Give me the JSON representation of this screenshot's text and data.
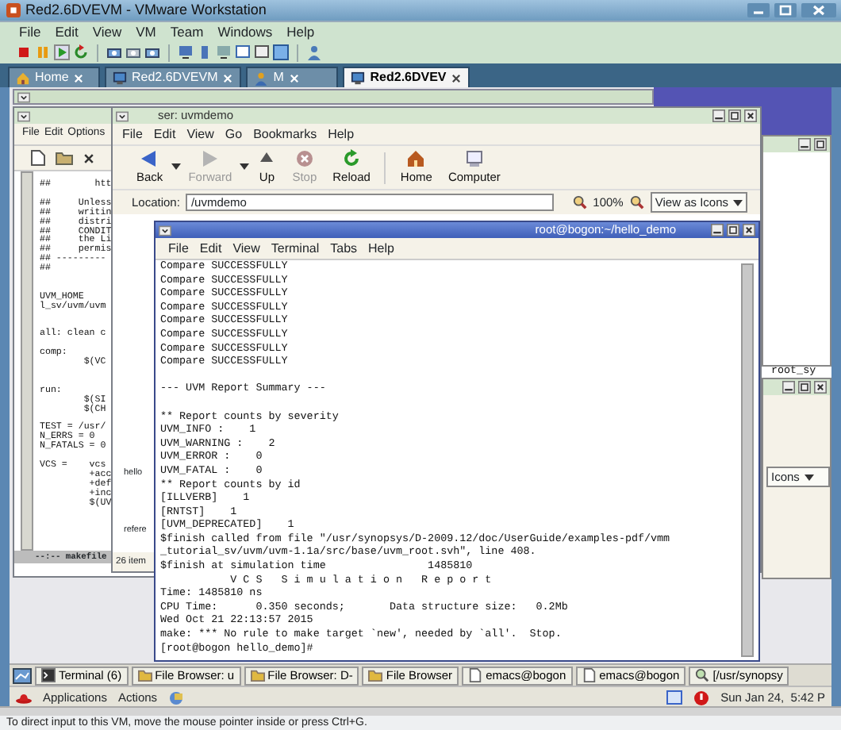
{
  "window": {
    "title": "Red2.6DVEVM - VMware Workstation"
  },
  "menu": [
    "File",
    "Edit",
    "View",
    "VM",
    "Team",
    "Windows",
    "Help"
  ],
  "vm_tabs": [
    {
      "label": "Home",
      "kind": "home",
      "selected": false
    },
    {
      "label": "Red2.6DVEVM",
      "kind": "vm",
      "selected": false
    },
    {
      "label": "M",
      "kind": "user",
      "selected": false
    },
    {
      "label": "Red2.6DVEV",
      "kind": "vm",
      "selected": true
    }
  ],
  "emacs": {
    "menu": [
      "File",
      "Edit",
      "Options"
    ],
    "lines": [
      {
        "kind": "text",
        "text": "##        htt"
      },
      {
        "kind": "blank"
      },
      {
        "kind": "text",
        "text": "##     Unless"
      },
      {
        "kind": "text",
        "text": "##     writin"
      },
      {
        "kind": "text",
        "text": "##     distri"
      },
      {
        "kind": "text",
        "text": "##     CONDIT"
      },
      {
        "kind": "text",
        "text": "##     the Li"
      },
      {
        "kind": "text",
        "text": "##     permis"
      },
      {
        "kind": "text",
        "text": "## ---------"
      },
      {
        "kind": "text",
        "text": "##"
      },
      {
        "kind": "blank"
      },
      {
        "kind": "blank"
      },
      {
        "kind": "text",
        "text": "UVM_HOME"
      },
      {
        "kind": "text",
        "text": "l_sv/uvm/uvm"
      },
      {
        "kind": "blank"
      },
      {
        "kind": "blank"
      },
      {
        "kind": "text",
        "text": "all: clean c"
      },
      {
        "kind": "blank"
      },
      {
        "kind": "text",
        "text": "comp:"
      },
      {
        "kind": "text",
        "text": "        $(VC"
      },
      {
        "kind": "blank"
      },
      {
        "kind": "blank"
      },
      {
        "kind": "text",
        "text": "run:"
      },
      {
        "kind": "text",
        "text": "        $(SI"
      },
      {
        "kind": "text",
        "text": "        $(CH"
      },
      {
        "kind": "blank"
      },
      {
        "kind": "text",
        "text": "TEST = /usr/"
      },
      {
        "kind": "text",
        "text": "N_ERRS = 0"
      },
      {
        "kind": "text",
        "text": "N_FATALS = 0"
      },
      {
        "kind": "blank"
      },
      {
        "kind": "text",
        "text": "VCS =    vcs"
      },
      {
        "kind": "text",
        "text": "         +acc"
      },
      {
        "kind": "text",
        "text": "         +def"
      },
      {
        "kind": "text",
        "text": "         +inc"
      },
      {
        "kind": "text",
        "text": "         $(UV"
      }
    ],
    "mode_line": "--:-- makefile"
  },
  "file_browser": {
    "title": "ser: uvmdemo",
    "menu": [
      "File",
      "Edit",
      "View",
      "Go",
      "Bookmarks",
      "Help"
    ],
    "toolbar": [
      {
        "label": "Back",
        "kind": "back",
        "disabled": false,
        "has_menu": true
      },
      {
        "label": "Forward",
        "kind": "forward",
        "disabled": true,
        "has_menu": true
      },
      {
        "label": "Up",
        "kind": "up",
        "disabled": false,
        "has_menu": false
      },
      {
        "label": "Stop",
        "kind": "stop",
        "disabled": true,
        "has_menu": false
      },
      {
        "label": "Reload",
        "kind": "reload",
        "disabled": false,
        "has_menu": false
      },
      {
        "label": "Home",
        "kind": "home",
        "disabled": false,
        "has_menu": false
      },
      {
        "label": "Computer",
        "kind": "computer",
        "disabled": false,
        "has_menu": false
      }
    ],
    "location_label": "Location:",
    "location": "/uvmdemo",
    "zoom": "100%",
    "view_mode": "View as Icons",
    "items": [
      "hello",
      "refere"
    ],
    "status": "26 item"
  },
  "terminal": {
    "title": "root@bogon:~/hello_demo",
    "menu": [
      "File",
      "Edit",
      "View",
      "Terminal",
      "Tabs",
      "Help"
    ],
    "lines": [
      {
        "kind": "text",
        "text": "Compare SUCCESSFULLY"
      },
      {
        "kind": "text",
        "text": "Compare SUCCESSFULLY"
      },
      {
        "kind": "text",
        "text": "Compare SUCCESSFULLY"
      },
      {
        "kind": "text",
        "text": "Compare SUCCESSFULLY"
      },
      {
        "kind": "text",
        "text": "Compare SUCCESSFULLY"
      },
      {
        "kind": "text",
        "text": "Compare SUCCESSFULLY"
      },
      {
        "kind": "text",
        "text": "Compare SUCCESSFULLY"
      },
      {
        "kind": "text",
        "text": "Compare SUCCESSFULLY"
      },
      {
        "kind": "blank"
      },
      {
        "kind": "text",
        "text": "--- UVM Report Summary ---"
      },
      {
        "kind": "blank"
      },
      {
        "kind": "text",
        "text": "** Report counts by severity"
      },
      {
        "kind": "text",
        "text": "UVM_INFO :    1"
      },
      {
        "kind": "text",
        "text": "UVM_WARNING :    2"
      },
      {
        "kind": "text",
        "text": "UVM_ERROR :    0"
      },
      {
        "kind": "text",
        "text": "UVM_FATAL :    0"
      },
      {
        "kind": "text",
        "text": "** Report counts by id"
      },
      {
        "kind": "text",
        "text": "[ILLVERB]    1"
      },
      {
        "kind": "text",
        "text": "[RNTST]    1"
      },
      {
        "kind": "text",
        "text": "[UVM_DEPRECATED]    1"
      },
      {
        "kind": "text",
        "text": "$finish called from file \"/usr/synopsys/D-2009.12/doc/UserGuide/examples-pdf/vmm"
      },
      {
        "kind": "text",
        "text": "_tutorial_sv/uvm/uvm-1.1a/src/base/uvm_root.svh\", line 408."
      },
      {
        "kind": "text",
        "text": "$finish at simulation time                1485810"
      },
      {
        "kind": "text",
        "text": "           V C S   S i m u l a t i o n   R e p o r t"
      },
      {
        "kind": "text",
        "text": "Time: 1485810 ns"
      },
      {
        "kind": "text",
        "text": "CPU Time:      0.350 seconds;       Data structure size:   0.2Mb"
      },
      {
        "kind": "text",
        "text": "Wed Oct 21 22:13:57 2015"
      },
      {
        "kind": "text",
        "text": "make: *** No rule to make target `new', needed by `all'.  Stop."
      },
      {
        "kind": "text",
        "text": "[root@bogon hello_demo]#"
      }
    ]
  },
  "side_window": {
    "text": "root_sy",
    "view_mode": "Icons"
  },
  "taskbar": [
    {
      "label": "Terminal (6)",
      "kind": "terminal"
    },
    {
      "label": "File Browser: u",
      "kind": "folder"
    },
    {
      "label": "File Browser: D-",
      "kind": "folder"
    },
    {
      "label": "File Browser",
      "kind": "folder"
    },
    {
      "label": "emacs@bogon",
      "kind": "document"
    },
    {
      "label": "emacs@bogon",
      "kind": "document"
    },
    {
      "label": "[/usr/synopsy",
      "kind": "search"
    }
  ],
  "panel": {
    "menu": [
      "Applications",
      "Actions"
    ],
    "clock": "Sun Jan 24,  5:42 P"
  },
  "status_bar": "To direct input to this VM, move the mouse pointer inside or press Ctrl+G."
}
